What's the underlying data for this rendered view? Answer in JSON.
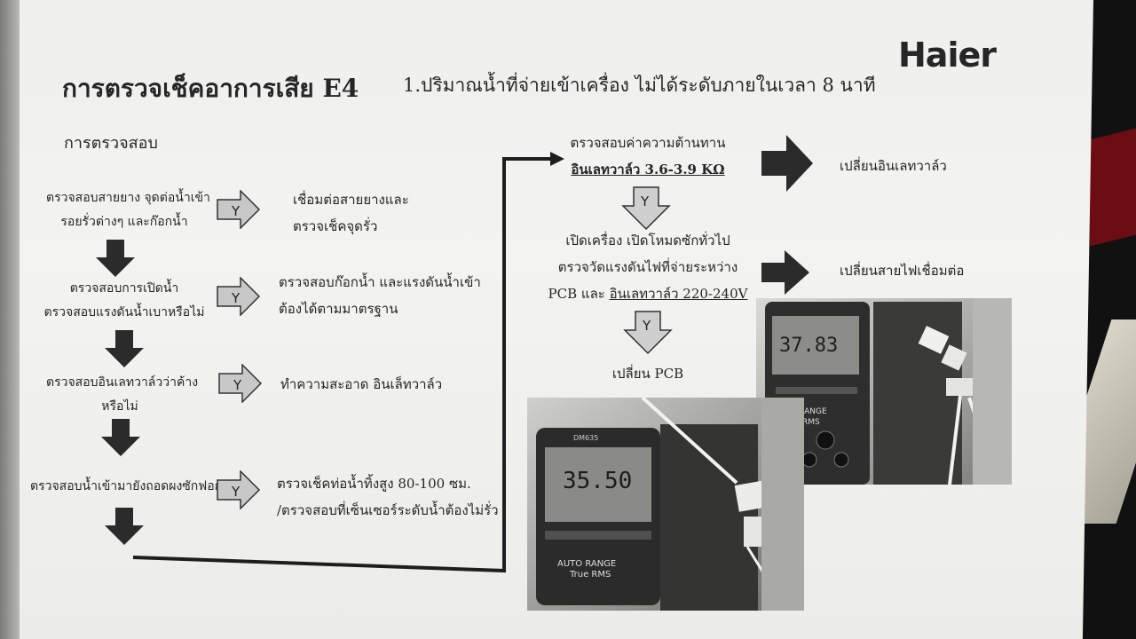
{
  "logo": "Haier",
  "title": "การตรวจเช็คอาการเสีย E4",
  "subtitle": "1.ปริมาณน้ำที่จ่ายเข้าเครื่อง ไม่ได้ระดับภายในเวลา 8 นาที",
  "section_heading": "การตรวจสอบ",
  "yes_label": "Y",
  "steps": [
    {
      "check": [
        "ตรวจสอบสายยาง จุดต่อน้ำเข้า",
        "รอยรั่วต่างๆ และก๊อกน้ำ"
      ],
      "action": [
        "เชื่อมต่อสายยางและ",
        "ตรวจเช็คจุดรั่ว"
      ]
    },
    {
      "check": [
        "ตรวจสอบการเปิดน้ำ",
        "ตรวจสอบแรงดันน้ำเบาหรือไม่"
      ],
      "action": [
        "ตรวจสอบก๊อกน้ำ และแรงดันน้ำเข้า",
        "ต้องได้ตามมาตรฐาน"
      ]
    },
    {
      "check": [
        "ตรวจสอบอินเลทวาล์วว่าค้าง",
        "หรือไม่"
      ],
      "action": [
        "ทำความสะอาด อินเล็ทวาล์ว"
      ]
    },
    {
      "check": [
        "ตรวจสอบน้ำเข้ามายังถอดผงซักฟอก"
      ],
      "action": [
        "ตรวจเช็คท่อน้ำทิ้งสูง 80-100 ซม.",
        "/ตรวจสอบที่เซ็นเซอร์ระดับน้ำต้องไม่รั่ว"
      ]
    }
  ],
  "right_flow": {
    "check1_line1": "ตรวจสอบค่าความต้านทาน",
    "check1_line2": "อินเลทวาล์ว 3.6-3.9 KΩ",
    "result1": "เปลี่ยนอินเลทวาล์ว",
    "check2_line1": "เปิดเครื่อง เปิดโหมดซักทั่วไป",
    "check2_line2": "ตรวจวัดแรงดันไฟที่จ่ายระหว่าง",
    "check2_line3_a": "PCB และ ",
    "check2_line3_b": "อินเลทวาล์ว 220-240V",
    "result2": "เปลี่ยนสายไฟเชื่อมต่อ",
    "final": "เปลี่ยน PCB"
  },
  "meter_photo_1": {
    "display": "37.83",
    "brand": "AUTO RANGE",
    "mode": "True RMS"
  },
  "meter_photo_2": {
    "display": "35.50",
    "model": "DM635",
    "brand": "AUTO RANGE",
    "mode": "True RMS"
  }
}
